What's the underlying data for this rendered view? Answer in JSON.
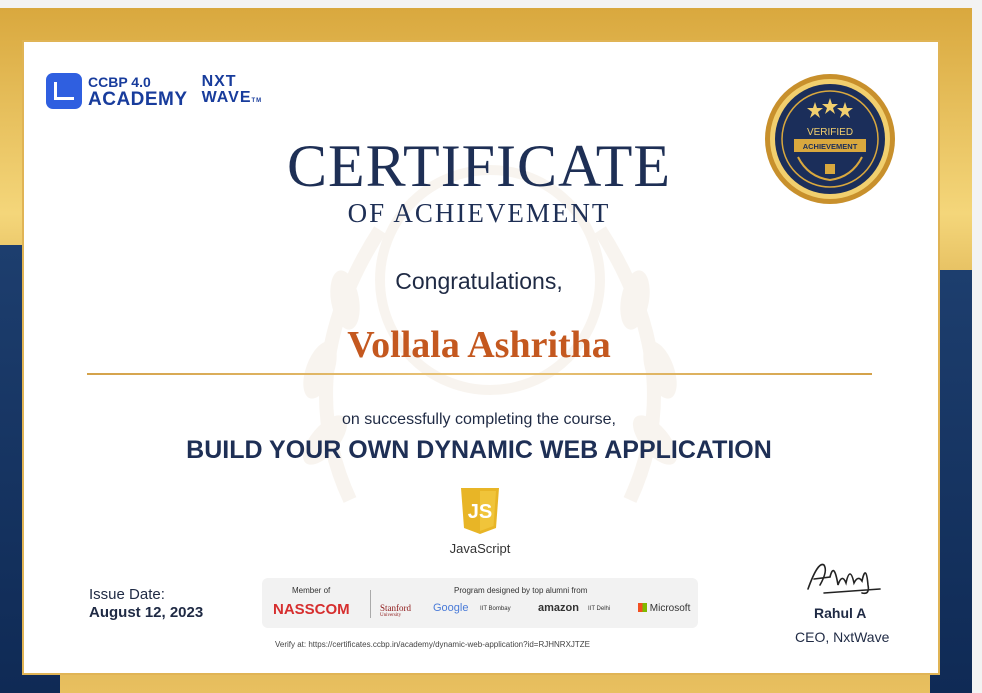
{
  "brand": {
    "logo_top": "CCBP 4.0",
    "logo_bottom": "ACADEMY",
    "nxt_top": "NXT",
    "nxt_bottom": "WAVE",
    "nxt_tm": "TM"
  },
  "certificate": {
    "title": "CERTIFICATE",
    "subtitle": "OF ACHIEVEMENT",
    "congrats": "Congratulations,",
    "recipient": "Vollala Ashritha",
    "completion_text": "on successfully completing the course,",
    "course": "BUILD YOUR OWN DYNAMIC WEB APPLICATION",
    "tech_label": "JavaScript",
    "tech_icon": "JS"
  },
  "seal": {
    "line1": "VERIFIED",
    "line2": "ACHIEVEMENT"
  },
  "issue": {
    "label": "Issue Date:",
    "date": "August 12, 2023"
  },
  "partners": {
    "member_label": "Member of",
    "member": "NASSCOM",
    "program_label": "Program designed by top alumni from",
    "list": [
      "Stanford",
      "Google",
      "IIT Bombay",
      "amazon",
      "IIT Delhi",
      "Microsoft"
    ],
    "stanford_sub": "University"
  },
  "verify": "Verify at: https://certificates.ccbp.in/academy/dynamic-web-application?id=RJHNRXJTZE",
  "signatory": {
    "name": "Rahul A",
    "title": "CEO, NxtWave"
  },
  "colors": {
    "navy": "#1e2f55",
    "gold": "#d9a83e",
    "name_orange": "#c4581f"
  }
}
